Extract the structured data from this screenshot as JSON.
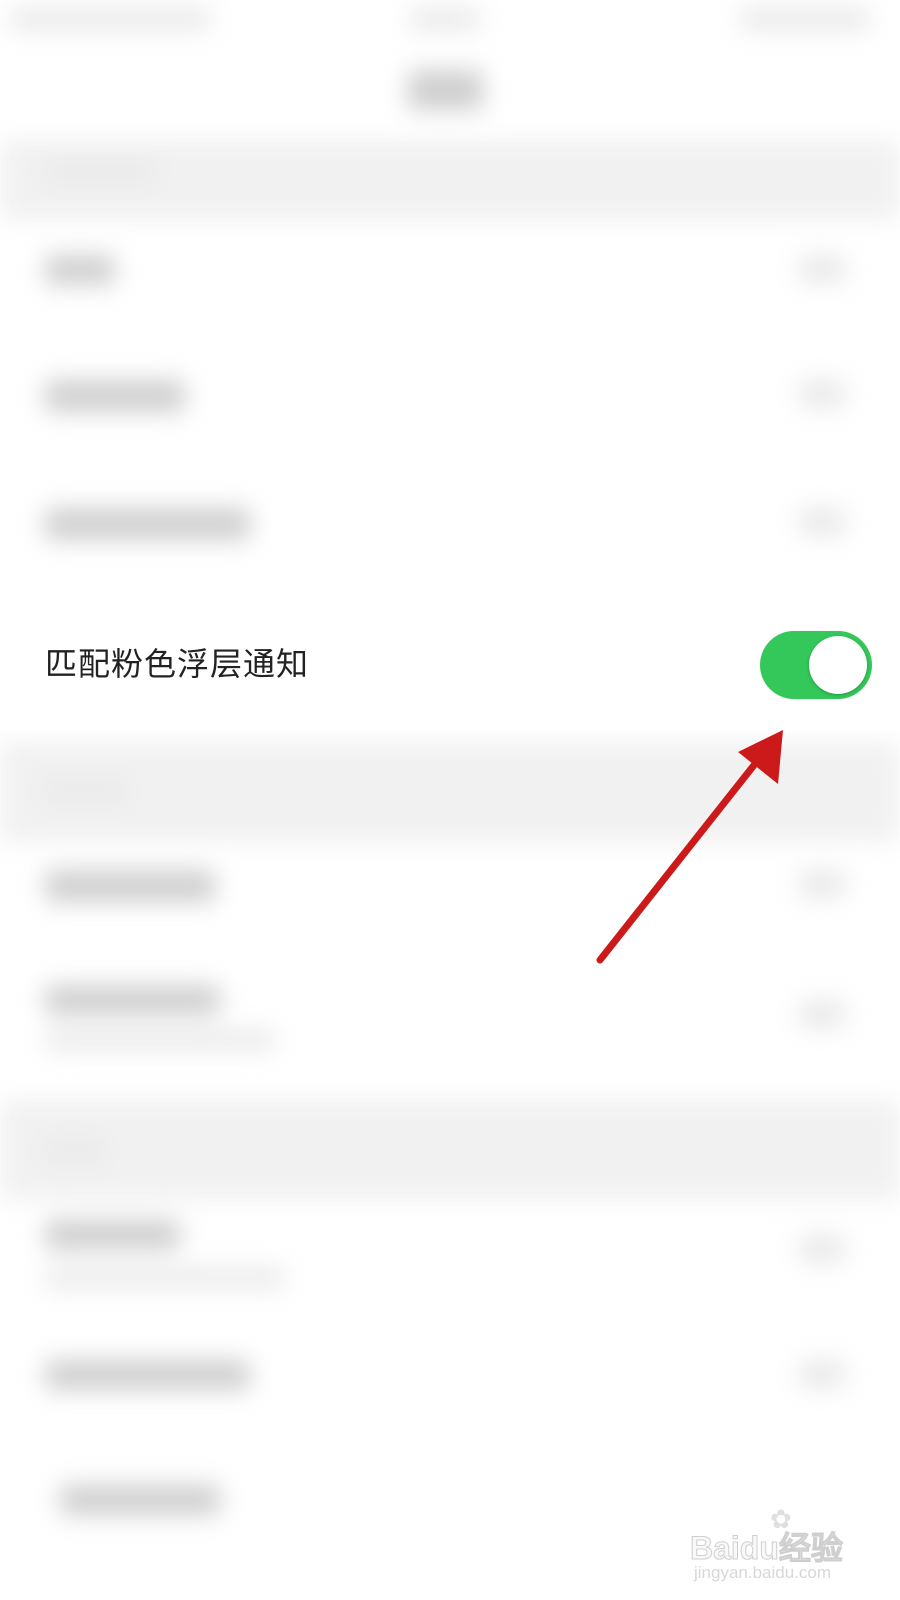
{
  "setting": {
    "label": "匹配粉色浮层通知",
    "toggle_on": true
  },
  "colors": {
    "toggle_on": "#34c759",
    "arrow": "#cc1a1a",
    "page_bg": "#ffffff",
    "section_bg": "#f2f2f2"
  },
  "watermark": {
    "main": "Bai",
    "main_end": "经验",
    "sub": "jingyan.baidu.com"
  }
}
